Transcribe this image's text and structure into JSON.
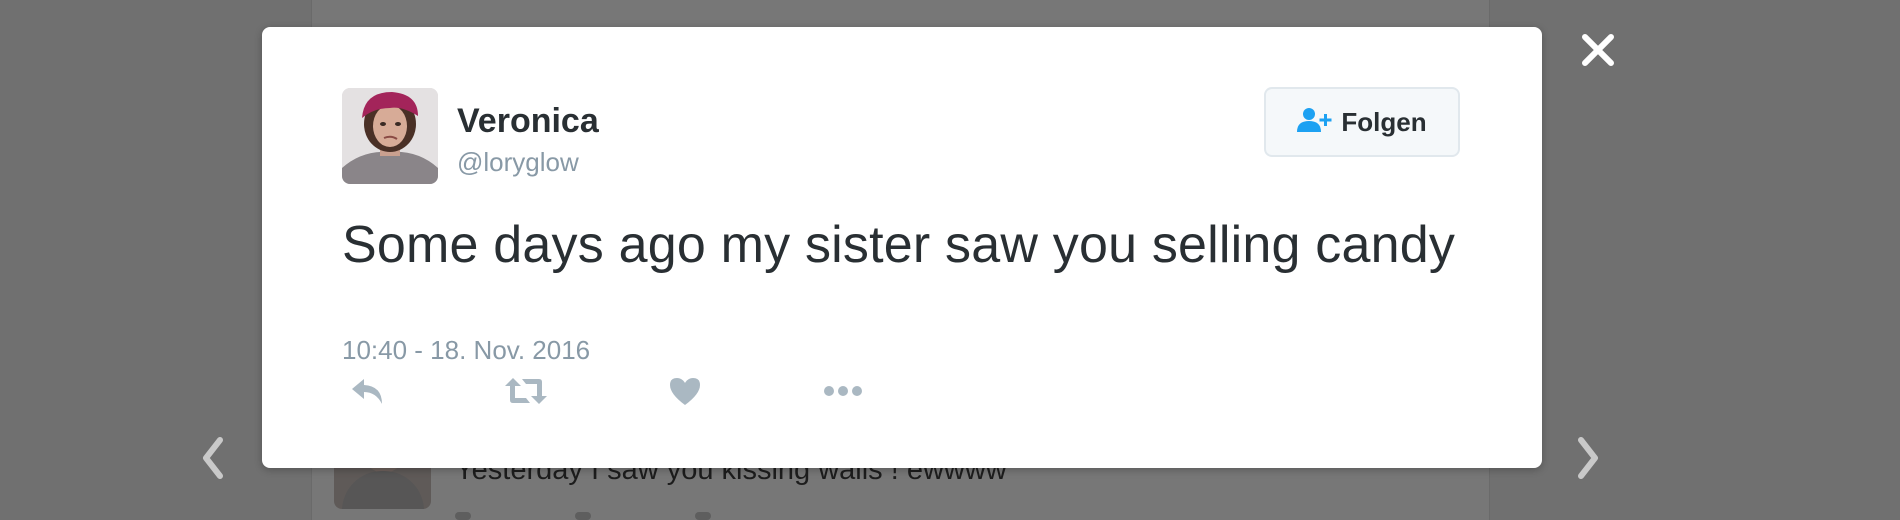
{
  "background_tweet": {
    "text": "Yesterday I saw you kissing walls ! ewwww"
  },
  "tweet": {
    "display_name": "Veronica",
    "handle": "@loryglow",
    "text": "Some days ago my sister saw you selling candy",
    "timestamp": "10:40 - 18. Nov. 2016"
  },
  "follow_button": {
    "label": "Folgen",
    "icon": "add-user-icon"
  },
  "actions": [
    "reply-icon",
    "retweet-icon",
    "like-icon",
    "more-icon"
  ],
  "colors": {
    "overlay": "#707070",
    "text_primary": "#292f33",
    "text_secondary": "#8899a6",
    "icon_gray": "#aab8c2",
    "brand_blue": "#1da1f2",
    "button_bg": "#f5f8fa",
    "button_border": "#e1e8ed"
  }
}
